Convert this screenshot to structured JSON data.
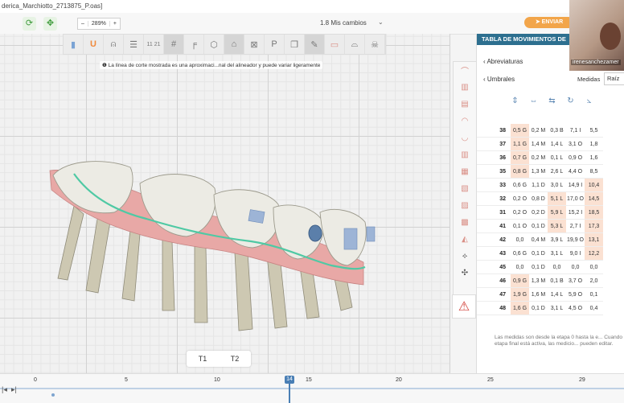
{
  "window": {
    "title": "derica_Marchiotto_2713875_P.oas]"
  },
  "toolbar": {
    "zoom_minus": "–",
    "zoom_value": "289%",
    "zoom_plus": "+",
    "changes": "1.8 Mis cambios",
    "send": "ENVIAR"
  },
  "notice": "La línea de corte mostrada es una aproximaci...nal del alineador y puede variar ligeramente",
  "stages": {
    "t1": "T1",
    "t2": "T2"
  },
  "panel": {
    "title": "TABLA DE MOVIMIENTOS DE",
    "abbr": "Abreviaturas",
    "thresholds": "Umbrales",
    "measures_label": "Medidas",
    "measures_value": "Raíz",
    "rows": [
      {
        "tooth": "38",
        "cells": [
          "0,5 G",
          "0,2 M",
          "0,3 B",
          "7,1 I",
          "5,5"
        ],
        "hl": [
          0
        ]
      },
      {
        "tooth": "37",
        "cells": [
          "1,1 G",
          "1,4 M",
          "1,4 L",
          "3,1 O",
          "1,8"
        ],
        "hl": [
          0
        ]
      },
      {
        "tooth": "36",
        "cells": [
          "0,7 G",
          "0,2 M",
          "0,1 L",
          "0,9 O",
          "1,6"
        ],
        "hl": [
          0
        ]
      },
      {
        "tooth": "35",
        "cells": [
          "0,8 G",
          "1,3 M",
          "2,6 L",
          "4,4 O",
          "8,5"
        ],
        "hl": [
          0
        ]
      },
      {
        "tooth": "33",
        "cells": [
          "0,6 G",
          "1,1 D",
          "3,0 L",
          "14,9 I",
          "10,4"
        ],
        "hl": [
          4
        ]
      },
      {
        "tooth": "32",
        "cells": [
          "0,2 O",
          "0,8 D",
          "5,1 L",
          "17,0 O",
          "14,5"
        ],
        "hl": [
          2,
          4
        ]
      },
      {
        "tooth": "31",
        "cells": [
          "0,2 O",
          "0,2 D",
          "5,9 L",
          "15,2 I",
          "18,5"
        ],
        "hl": [
          2,
          4
        ]
      },
      {
        "tooth": "41",
        "cells": [
          "0,1 O",
          "0,1 D",
          "5,3 L",
          "2,7 I",
          "17,3"
        ],
        "hl": [
          2,
          4
        ]
      },
      {
        "tooth": "42",
        "cells": [
          "0,0",
          "0,4 M",
          "3,9 L",
          "19,9 O",
          "13,1"
        ],
        "hl": [
          4
        ]
      },
      {
        "tooth": "43",
        "cells": [
          "0,6 G",
          "0,1 D",
          "3,1 L",
          "9,0 I",
          "12,2"
        ],
        "hl": [
          4
        ]
      },
      {
        "tooth": "45",
        "cells": [
          "0,0",
          "0,1 D",
          "0,0",
          "0,0",
          "0,0"
        ],
        "hl": []
      },
      {
        "tooth": "46",
        "cells": [
          "0,9 G",
          "1,3 M",
          "0,1 B",
          "3,7 O",
          "2,0"
        ],
        "hl": [
          0
        ]
      },
      {
        "tooth": "47",
        "cells": [
          "1,9 G",
          "1,6 M",
          "1,4 L",
          "5,9 O",
          "0,1"
        ],
        "hl": [
          0
        ]
      },
      {
        "tooth": "48",
        "cells": [
          "1,6 G",
          "0,1 D",
          "3,1 L",
          "4,5 O",
          "0,4"
        ],
        "hl": [
          0
        ]
      }
    ],
    "footnote": "Las medidas son desde la etapa 0 hasta la e... Cuando la etapa final está activa, las medicio... pueden editar."
  },
  "webcam": {
    "name": "irenesanchezamer"
  },
  "timeline": {
    "ticks": [
      "0",
      "5",
      "10",
      "15",
      "20",
      "25"
    ],
    "current": "14",
    "total": "29"
  },
  "colors": {
    "accent": "#2d6f8f",
    "send": "#f2a54a",
    "highlight": "#fbe1d2",
    "gingiva": "#e8a8a6",
    "trimline": "#4fc9a4"
  }
}
